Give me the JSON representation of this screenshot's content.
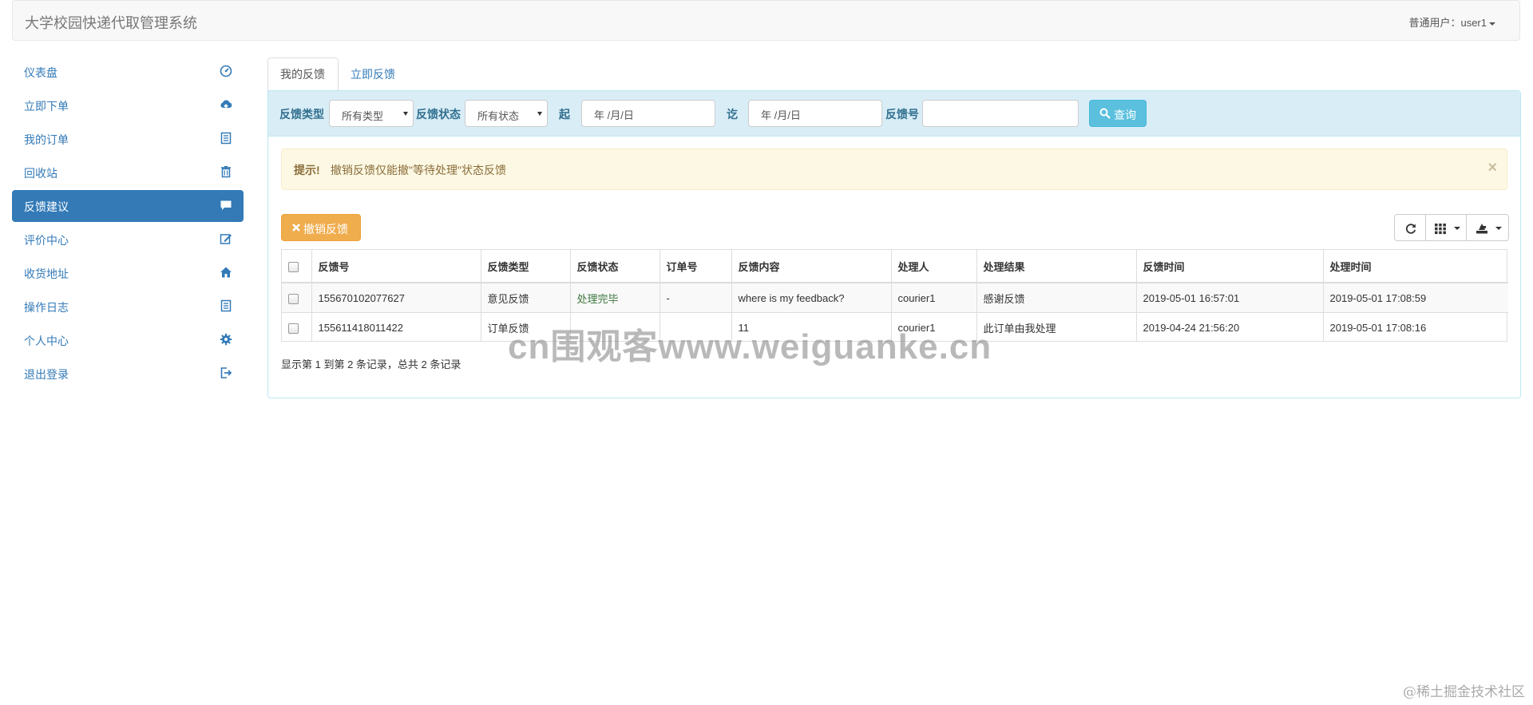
{
  "app": {
    "title": "大学校园快递代取管理系统",
    "user_label": "普通用户：user1"
  },
  "sidebar": {
    "items": [
      {
        "label": "仪表盘",
        "icon": "dashboard-icon",
        "active": false
      },
      {
        "label": "立即下单",
        "icon": "cloud-upload-icon",
        "active": false
      },
      {
        "label": "我的订单",
        "icon": "list-icon",
        "active": false
      },
      {
        "label": "回收站",
        "icon": "trash-icon",
        "active": false
      },
      {
        "label": "反馈建议",
        "icon": "comment-icon",
        "active": true
      },
      {
        "label": "评价中心",
        "icon": "edit-icon",
        "active": false
      },
      {
        "label": "收货地址",
        "icon": "home-icon",
        "active": false
      },
      {
        "label": "操作日志",
        "icon": "list-icon",
        "active": false
      },
      {
        "label": "个人中心",
        "icon": "gear-icon",
        "active": false
      },
      {
        "label": "退出登录",
        "icon": "logout-icon",
        "active": false
      }
    ]
  },
  "tabs": [
    {
      "label": "我的反馈",
      "active": true
    },
    {
      "label": "立即反馈",
      "active": false
    }
  ],
  "filters": {
    "type_label": "反馈类型",
    "type_value": "所有类型",
    "status_label": "反馈状态",
    "status_value": "所有状态",
    "start_label": "起",
    "start_value": "年 /月/日",
    "end_label": "讫",
    "end_value": "年 /月/日",
    "id_label": "反馈号",
    "id_value": "",
    "query_label": "查询"
  },
  "alert": {
    "strong": "提示!",
    "message": "撤销反馈仅能撤\"等待处理\"状态反馈",
    "close": "×"
  },
  "toolbar": {
    "cancel_label": "撤销反馈"
  },
  "table": {
    "columns": [
      "反馈号",
      "反馈类型",
      "反馈状态",
      "订单号",
      "反馈内容",
      "处理人",
      "处理结果",
      "反馈时间",
      "处理时间"
    ],
    "rows": [
      {
        "id": "155670102077627",
        "type": "意见反馈",
        "status": "处理完毕",
        "order": "-",
        "content": "where is my feedback?",
        "handler": "courier1",
        "result": "感谢反馈",
        "feedback_time": "2019-05-01 16:57:01",
        "handle_time": "2019-05-01 17:08:59"
      },
      {
        "id": "155611418011422",
        "type": "订单反馈",
        "status": "",
        "order": "",
        "content": "11",
        "handler": "courier1",
        "result": "此订单由我处理",
        "feedback_time": "2019-04-24 21:56:20",
        "handle_time": "2019-05-01 17:08:16"
      }
    ]
  },
  "pagination": {
    "info": "显示第 1 到第 2 条记录，总共 2 条记录"
  },
  "watermark": "cn围观客www.weiguanke.cn",
  "footer_mark": "@稀土掘金技术社区",
  "colors": {
    "primary": "#337ab7",
    "info": "#5bc0de",
    "warning": "#f0ad4e",
    "success_text": "#3c763d"
  }
}
